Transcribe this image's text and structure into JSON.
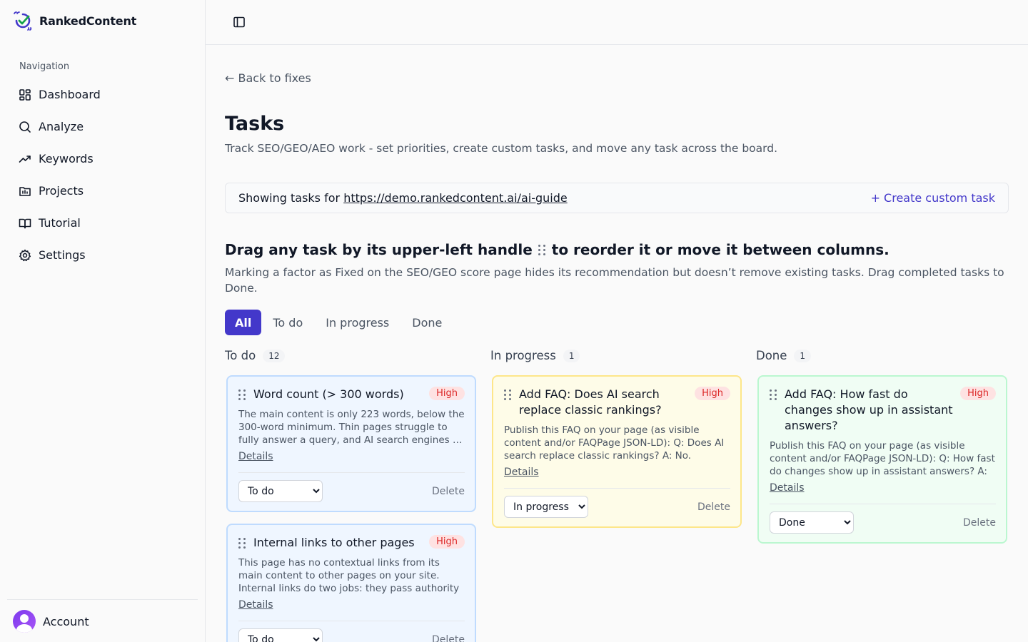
{
  "app": {
    "name": "RankedContent"
  },
  "sidebar": {
    "heading": "Navigation",
    "items": [
      {
        "label": "Dashboard",
        "icon": "dashboard-icon"
      },
      {
        "label": "Analyze",
        "icon": "search-icon"
      },
      {
        "label": "Keywords",
        "icon": "trend-icon"
      },
      {
        "label": "Projects",
        "icon": "folder-icon"
      },
      {
        "label": "Tutorial",
        "icon": "book-icon"
      },
      {
        "label": "Settings",
        "icon": "gear-icon"
      }
    ],
    "account_label": "Account"
  },
  "main": {
    "back_label": "← Back to fixes",
    "title": "Tasks",
    "subtitle": "Track SEO/GEO/AEO work - set priorities, create custom tasks, and move any task across the board.",
    "url_prefix": "Showing tasks for",
    "url": "https://demo.rankedcontent.ai/ai-guide",
    "create_label": "+ Create custom task",
    "drag_heading_before": "Drag any task by its upper-left handle",
    "drag_heading_after": "to reorder it or move it between columns.",
    "drag_note": "Marking a factor as Fixed on the SEO/GEO score page hides its recommendation but doesn’t remove existing tasks. Drag completed tasks to Done.",
    "filters": [
      "All",
      "To do",
      "In progress",
      "Done"
    ],
    "active_filter": "All"
  },
  "columns": [
    {
      "title": "To do",
      "count": "12",
      "cards": [
        {
          "title": "Word count (> 300 words)",
          "priority": "High",
          "description": "The main content is only 223 words, below the 300-word minimum. Thin pages struggle to fully answer a query, and AI search engines …",
          "details_label": "Details",
          "status": "To do",
          "delete_label": "Delete"
        },
        {
          "title": "Internal links to other pages",
          "priority": "High",
          "description": "This page has no contextual links from its main content to other pages on your site. Internal links do two jobs: they pass authority (link …",
          "details_label": "Details",
          "status": "To do",
          "delete_label": "Delete"
        }
      ]
    },
    {
      "title": "In progress",
      "count": "1",
      "cards": [
        {
          "title": "Add FAQ: Does AI search replace classic rankings?",
          "priority": "High",
          "description": "Publish this FAQ on your page (as visible content and/or FAQPage JSON-LD): Q: Does AI search replace classic rankings? A: No. Rankin…",
          "details_label": "Details",
          "status": "In progress",
          "delete_label": "Delete"
        }
      ]
    },
    {
      "title": "Done",
      "count": "1",
      "cards": [
        {
          "title": "Add FAQ: How fast do changes show up in assistant answers?",
          "priority": "High",
          "description": "Publish this FAQ on your page (as visible content and/or FAQPage JSON-LD): Q: How fast do changes show up in assistant answers? A: …",
          "details_label": "Details",
          "status": "Done",
          "delete_label": "Delete"
        }
      ]
    }
  ],
  "status_options": [
    "To do",
    "In progress",
    "Done"
  ],
  "colors": {
    "accent": "#4338ca",
    "todo_bg": "#eff6ff",
    "inprogress_bg": "#fefce8",
    "done_bg": "#f0fdf4",
    "high_priority": "#dc2626"
  }
}
